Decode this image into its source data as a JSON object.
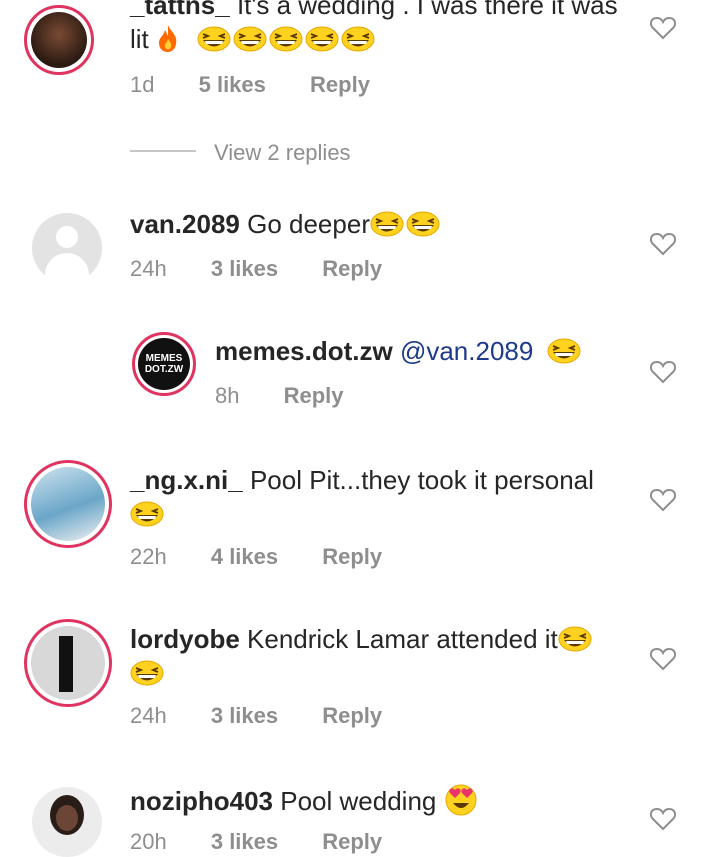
{
  "comments": [
    {
      "user": "_tattns_",
      "text": "It's a wedding . I was there it was lit",
      "time": "1d",
      "likes": "5 likes",
      "reply": "Reply",
      "extra_emoji": "fire-icon",
      "laughs": 5
    },
    {
      "user": "van.2089",
      "text": "Go deeper",
      "time": "24h",
      "likes": "3 likes",
      "reply": "Reply",
      "laughs": 2
    },
    {
      "user": "memes.dot.zw",
      "mention": "@van.2089",
      "time": "8h",
      "reply": "Reply",
      "laughs": 1,
      "logo": "MEMES DOT.ZW"
    },
    {
      "user": "_ng.x.ni_",
      "text": "Pool Pit...they took it personal",
      "time": "22h",
      "likes": "4 likes",
      "reply": "Reply",
      "laughs": 1
    },
    {
      "user": "lordyobe",
      "text": "Kendrick Lamar attended it",
      "time": "24h",
      "likes": "3 likes",
      "reply": "Reply",
      "laughs": 2
    },
    {
      "user": "nozipho403",
      "text": "Pool wedding",
      "time": "20h",
      "likes": "3 likes",
      "reply": "Reply",
      "heart_eyes": 1
    }
  ],
  "view_replies": "View 2 replies",
  "icons": {
    "like": "heart-outline-icon",
    "laugh": "grinning-squinting-emoji",
    "fire": "fire-emoji",
    "love": "heart-eyes-emoji"
  },
  "colors": {
    "ring": "#e0335f",
    "meta": "#8e8e8e",
    "mention": "#1e3a8a"
  }
}
